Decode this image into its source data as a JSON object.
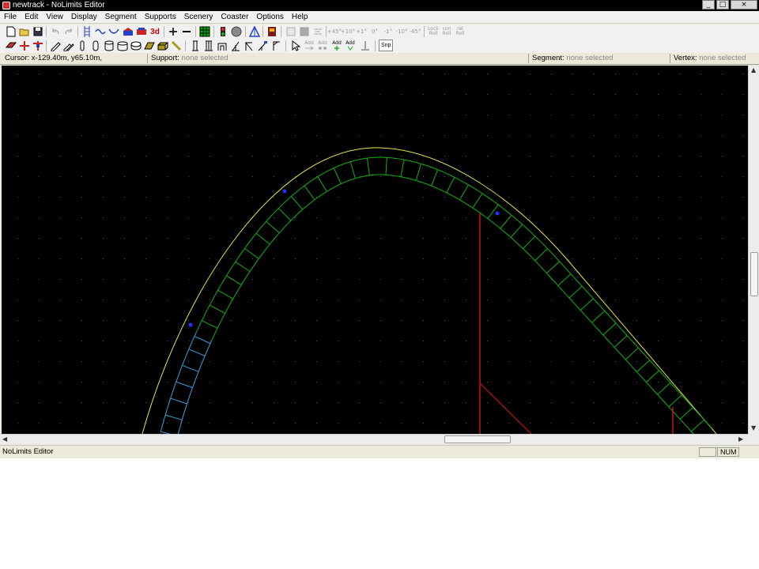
{
  "window": {
    "title": "newtrack - NoLimits Editor"
  },
  "menu": {
    "items": [
      "File",
      "Edit",
      "View",
      "Display",
      "Segment",
      "Supports",
      "Scenery",
      "Coaster",
      "Options",
      "Help"
    ]
  },
  "toolbar": {
    "three_d_label": "3d",
    "angle_buttons": [
      "+45°",
      "+10°",
      "+1°",
      "0°",
      "-1°",
      "-10°",
      "-45°"
    ],
    "lock_roll": [
      "Lock",
      "Roll"
    ],
    "con_roll": [
      "con",
      "Roll"
    ],
    "rel_roll": [
      "rel",
      "Roll"
    ],
    "add_labels": [
      "Add",
      "Add",
      "Add",
      "Add"
    ],
    "snap_label": "Snp"
  },
  "info": {
    "cursor_label": "Cursor:",
    "cursor_value": "x-129.40m, y65.10m,",
    "support_label": "Support:",
    "support_value": "none selected",
    "segment_label": "Segment:",
    "segment_value": "none selected",
    "vertex_label": "Vertex:",
    "vertex_value": "none selected"
  },
  "status": {
    "text": "NoLimits Editor",
    "num": "NUM"
  },
  "colors": {
    "track_green": "#11b111",
    "outline_yellow": "#e6e64a",
    "selected_blue": "#3aa0d8",
    "support_red": "#cc1111",
    "vertex_blue": "#2030ff",
    "grid_dot": "#555555"
  }
}
